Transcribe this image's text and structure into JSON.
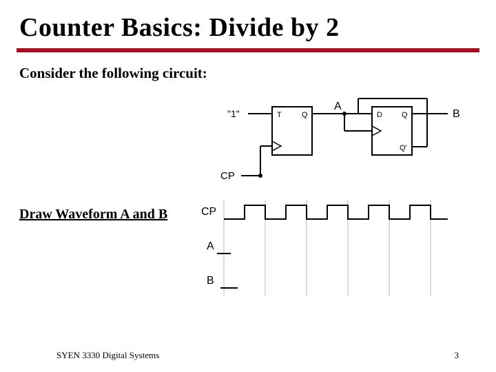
{
  "title": "Counter Basics:  Divide by 2",
  "subtitle": "Consider the following circuit:",
  "draw_title": "Draw Waveform A and B",
  "circuit": {
    "input": "\"1\"",
    "ff1": {
      "in": "T",
      "out": "Q"
    },
    "ff2": {
      "in": "D",
      "out1": "Q",
      "out2": "Q'"
    },
    "signal_a": "A",
    "signal_b": "B",
    "clock": "CP"
  },
  "waveform": {
    "clock": "CP",
    "row_a": "A",
    "row_b": "B"
  },
  "footer": {
    "course": "SYEN 3330 Digital Systems",
    "page": "3"
  }
}
